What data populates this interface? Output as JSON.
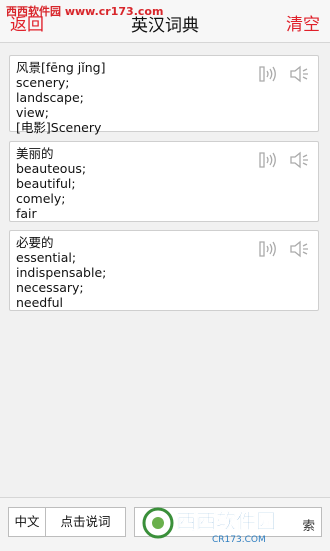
{
  "watermark": "西西软件园 www.cr173.com",
  "header": {
    "back": "返回",
    "title": "英汉词典",
    "clear": "清空"
  },
  "entries": [
    {
      "word": "风景[fēng jǐng]",
      "defs": [
        "scenery;",
        "landscape;",
        "view;",
        "[电影]Scenery"
      ]
    },
    {
      "word": "美丽的",
      "defs": [
        "beauteous;",
        "beautiful;",
        "comely;",
        "fair"
      ]
    },
    {
      "word": "必要的",
      "defs": [
        "essential;",
        "indispensable;",
        "necessary;",
        "needful"
      ]
    }
  ],
  "icons": {
    "voice": "voice-recognition-icon",
    "sound": "speaker-icon"
  },
  "bottom": {
    "lang": "中文",
    "talk": "点击说词",
    "search": "索"
  },
  "logo": {
    "text": "西西软件园",
    "sub": "CR173.COM"
  },
  "colors": {
    "accent": "#e0202a",
    "border": "#cfcfcf"
  }
}
